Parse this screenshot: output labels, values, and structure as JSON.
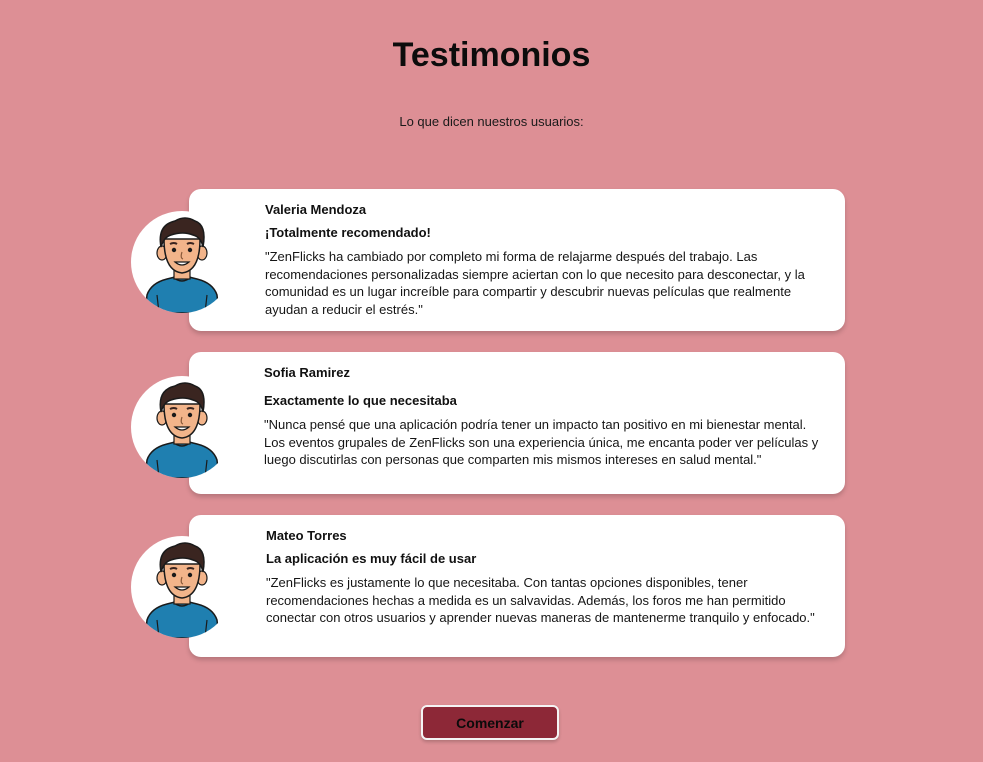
{
  "header": {
    "title": "Testimonios",
    "subtitle": "Lo que dicen nuestros usuarios:"
  },
  "testimonials": [
    {
      "name": "Valeria Mendoza",
      "headline": "¡Totalmente recomendado!",
      "quote": "\"ZenFlicks ha cambiado por completo mi forma de relajarme después del trabajo. Las recomendaciones personalizadas siempre aciertan con lo que necesito para desconectar, y la comunidad es un lugar increíble para compartir y descubrir nuevas películas que realmente ayudan a reducir el estrés.\"",
      "avatar_icon": "cartoon-man-avatar-icon"
    },
    {
      "name": "Sofia Ramirez",
      "headline": "Exactamente lo que necesitaba",
      "quote": "\"Nunca pensé que una aplicación podría tener un impacto tan positivo en mi bienestar mental. Los eventos grupales de ZenFlicks son una experiencia única, me encanta poder ver películas y luego discutirlas con personas que comparten mis mismos intereses en salud mental.\"",
      "avatar_icon": "cartoon-man-avatar-icon"
    },
    {
      "name": "Mateo Torres",
      "headline": "La aplicación es muy fácil de usar",
      "quote": "\"ZenFlicks es justamente lo que necesitaba. Con tantas opciones disponibles, tener recomendaciones hechas a medida es un salvavidas. Además, los foros me han permitido conectar con otros usuarios y aprender nuevas maneras de mantenerme tranquilo y enfocado.\"",
      "avatar_icon": "cartoon-man-avatar-icon"
    }
  ],
  "cta": {
    "label": "Comenzar"
  },
  "colors": {
    "background": "#dd8f95",
    "card": "#ffffff",
    "button": "#8d2837",
    "shirt": "#1f7fb0",
    "hair": "#3a2520",
    "skin": "#f2b48a"
  }
}
